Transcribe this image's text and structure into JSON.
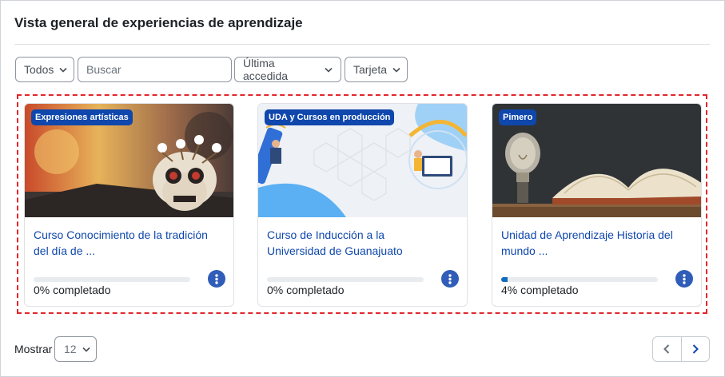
{
  "header": {
    "title": "Vista general de experiencias de aprendizaje"
  },
  "filters": {
    "grouping_label": "Todos",
    "search_placeholder": "Buscar",
    "sort_label": "Última accedida",
    "view_label": "Tarjeta"
  },
  "courses": [
    {
      "category": "Expresiones artísticas",
      "title": "Curso Conocimiento de la tradición del día de ...",
      "progress_text": "0% completado",
      "progress": 0
    },
    {
      "category": "UDA y Cursos en producción",
      "title": "Curso de Inducción a la Universidad de Guanajuato",
      "progress_text": "0% completado",
      "progress": 0
    },
    {
      "category": "Pimero",
      "title": "Unidad de Aprendizaje Historia del mundo ...",
      "progress_text": "4% completado",
      "progress": 4
    }
  ],
  "footer": {
    "show_label": "Mostrar",
    "per_page": "12"
  },
  "colors": {
    "accent": "#0f47ad",
    "highlight_border": "#e3262b",
    "progress_fill": "#0f6cbf"
  },
  "icons": [
    "chevron-down-icon",
    "more-options-icon",
    "chevron-left-icon",
    "chevron-right-icon"
  ]
}
